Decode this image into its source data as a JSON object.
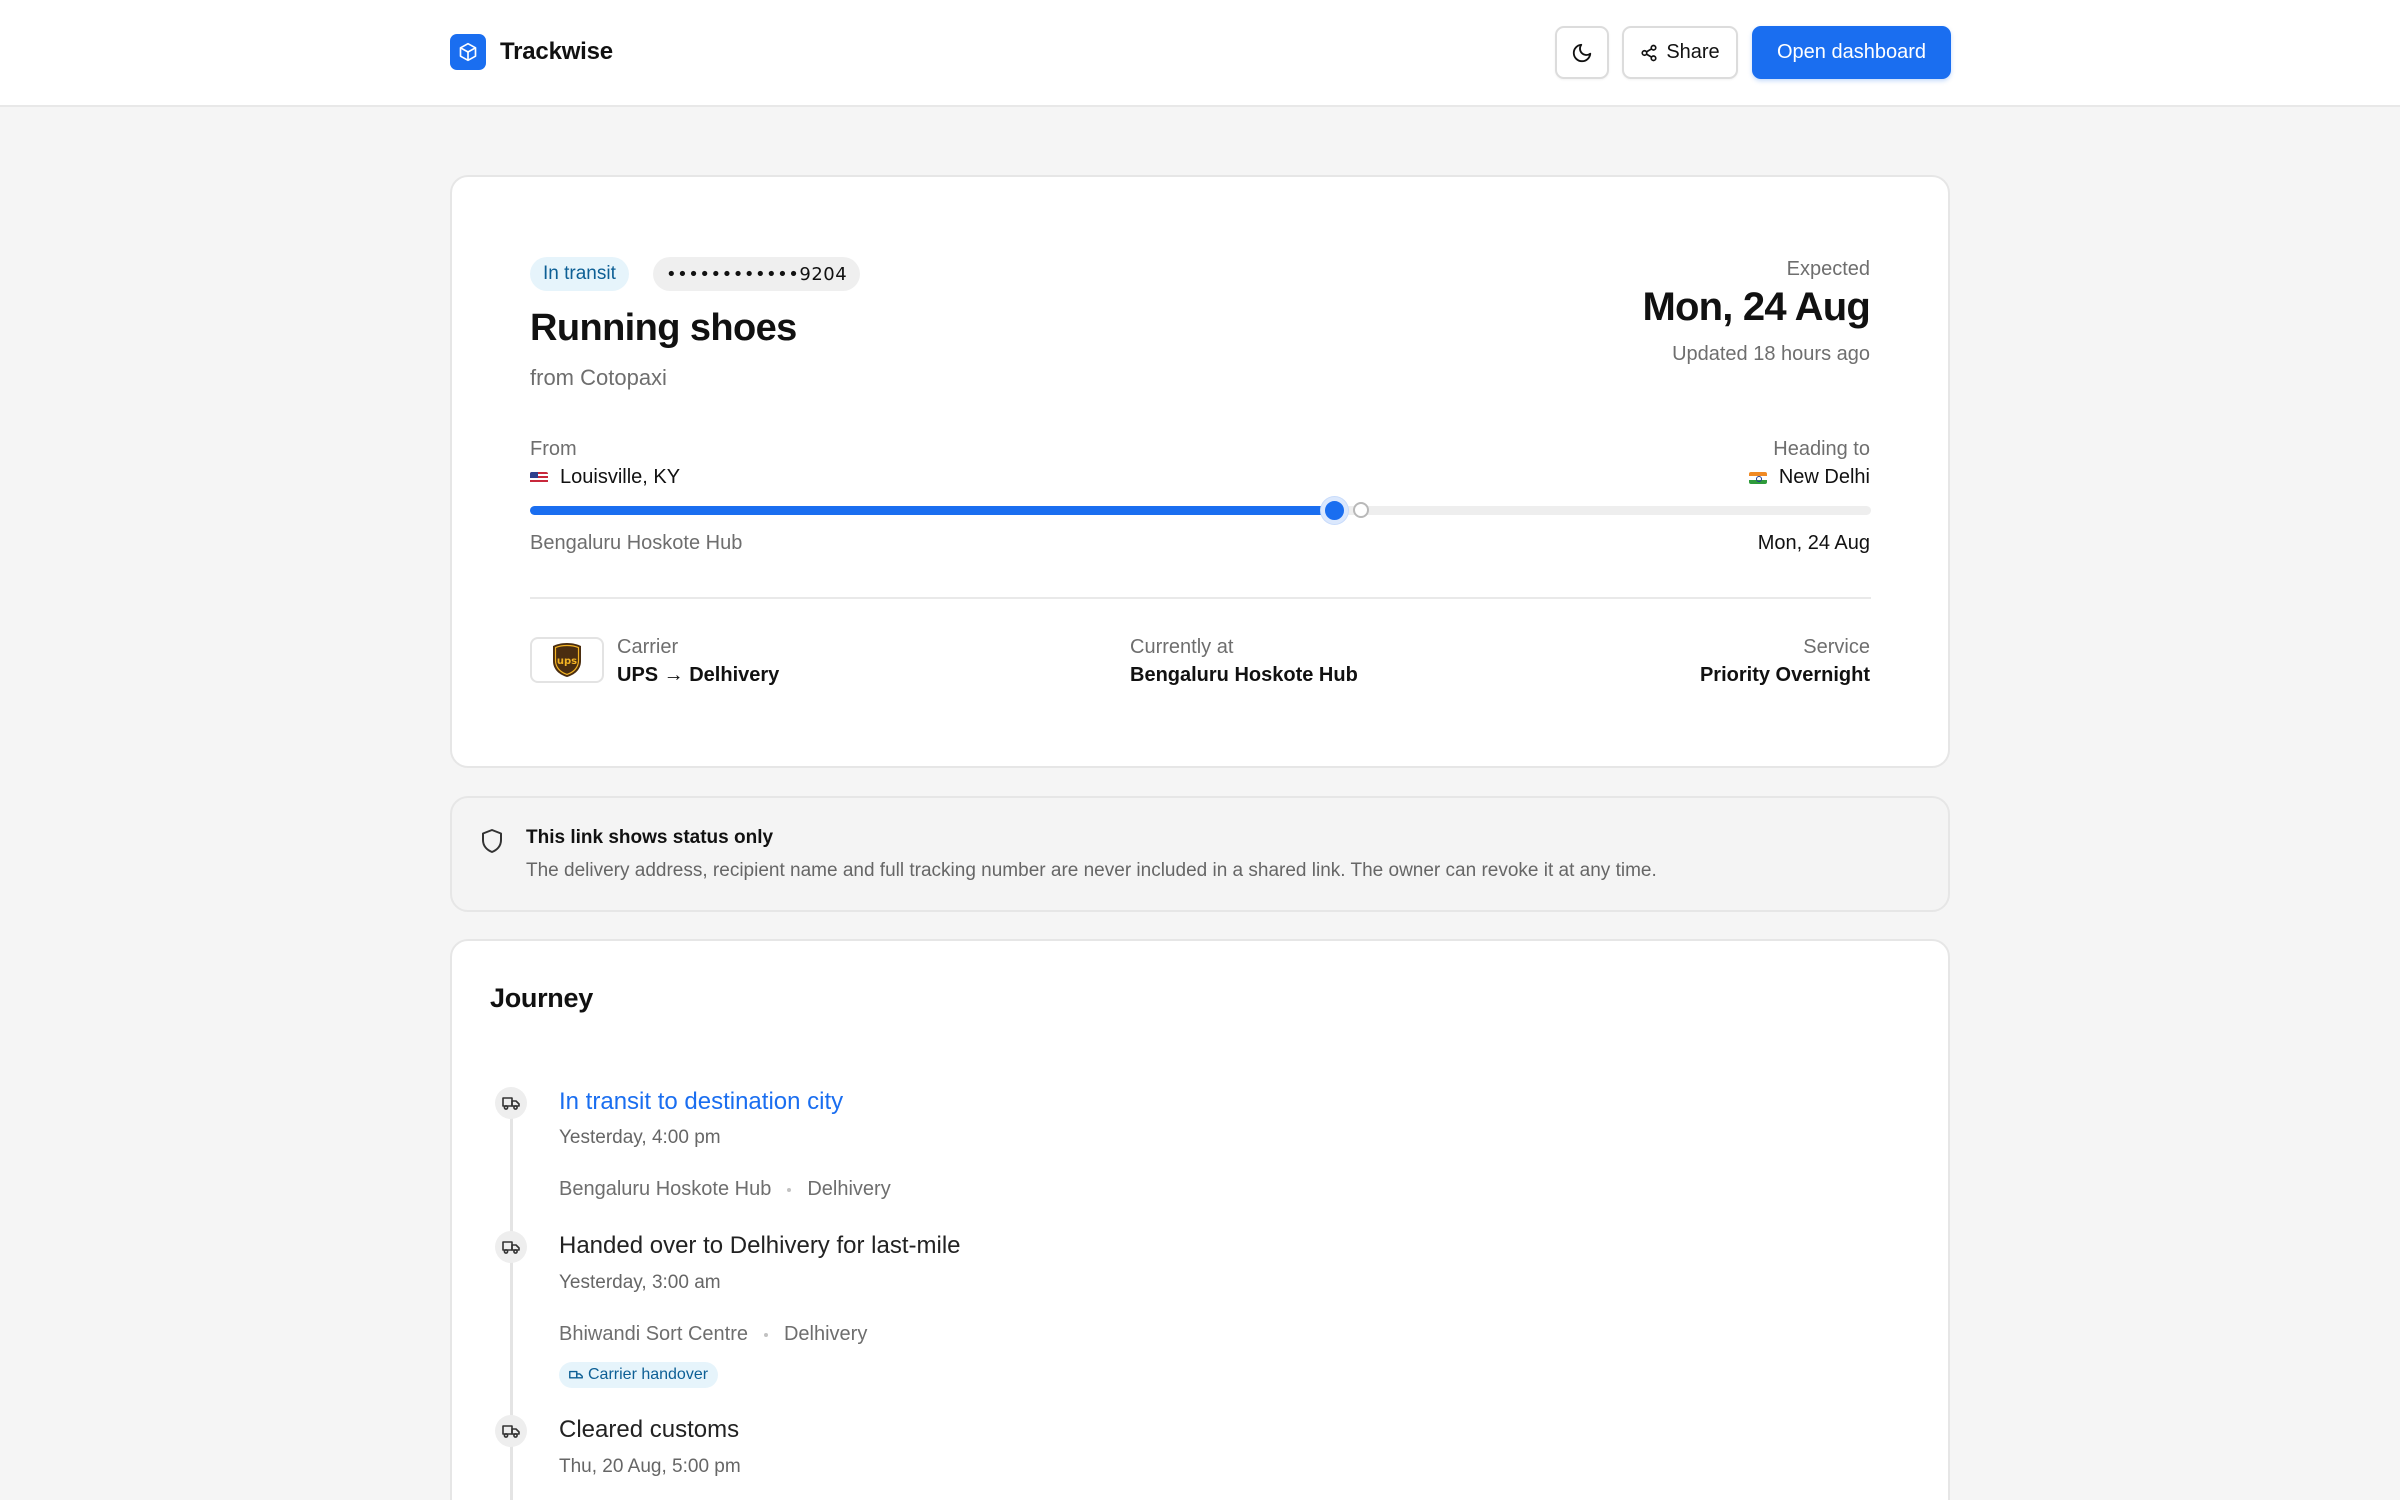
{
  "app": {
    "name": "Trackwise",
    "share_label": "Share",
    "open_dashboard_label": "Open dashboard",
    "accent_color": "#1a6ef0"
  },
  "shipment": {
    "status": "In transit",
    "tracking_masked": "••••••••••••9204",
    "title": "Running shoes",
    "merchant": "from Cotopaxi",
    "expected_label": "Expected",
    "expected_date": "Mon, 24 Aug",
    "updated": "Updated 18 hours ago"
  },
  "route": {
    "from_label": "From",
    "from_place": "Louisville, KY",
    "from_flag": "us-flag",
    "to_label": "Heading to",
    "to_place": "New Delhi",
    "to_flag": "india-flag",
    "progress": 0.6,
    "current_hub": "Bengaluru Hoskote Hub",
    "eta": "Mon, 24 Aug"
  },
  "meta": {
    "carrier_label": "Carrier",
    "carrier_value": "UPS → Delhivery",
    "carrier_logo": "ups-logo",
    "location_label": "Currently at",
    "location_value": "Bengaluru Hoskote Hub",
    "service_label": "Service",
    "service_value": "Priority Overnight"
  },
  "privacy_note": {
    "title": "This link shows status only",
    "body": "The delivery address, recipient name and full tracking number are never included in a shared link. The owner can revoke it at any time."
  },
  "journey": {
    "title": "Journey",
    "events": [
      {
        "title": "In transit to destination city",
        "time": "Yesterday, 4:00 pm",
        "location": "Bengaluru Hoskote Hub",
        "carrier": "Delhivery",
        "icon": "truck-icon",
        "active": true
      },
      {
        "title": "Handed over to Delhivery for last-mile",
        "time": "Yesterday, 3:00 am",
        "location": "Bhiwandi Sort Centre",
        "carrier": "Delhivery",
        "badge": "Carrier handover",
        "icon": "truck-icon"
      },
      {
        "title": "Cleared customs",
        "time": "Thu, 20 Aug, 5:00 pm",
        "icon": "truck-icon"
      }
    ]
  }
}
